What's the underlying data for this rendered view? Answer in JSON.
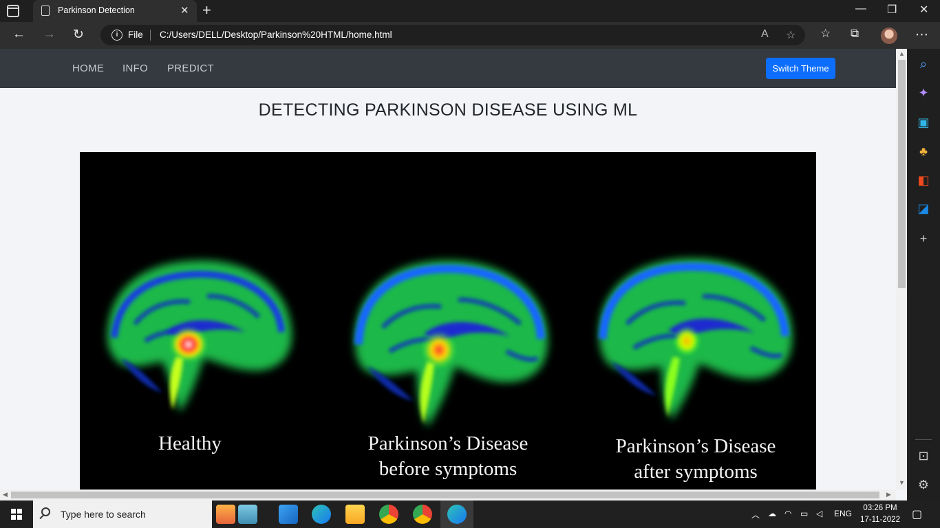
{
  "browser": {
    "tab_title": "Parkinson Detection",
    "tab_close_glyph": "✕",
    "new_tab_glyph": "+",
    "file_label": "File",
    "url": "C:/Users/DELL/Desktop/Parkinson%20HTML/home.html",
    "window_controls": [
      "—",
      "❐",
      "✕"
    ]
  },
  "site": {
    "nav_links": [
      "HOME",
      "INFO",
      "PREDICT"
    ],
    "switch_theme_label": "Switch Theme",
    "page_title": "DETECTING PARKINSON DISEASE USING ML",
    "hero_captions": [
      {
        "line1": "Healthy",
        "line2": ""
      },
      {
        "line1": "Parkinson’s Disease",
        "line2": "before symptoms"
      },
      {
        "line1": "Parkinson’s Disease",
        "line2": "after symptoms"
      }
    ]
  },
  "taskbar": {
    "search_placeholder": "Type here to search",
    "language": "ENG",
    "time": "03:26 PM",
    "date": "17-11-2022"
  },
  "colors": {
    "accent": "#0d6efd",
    "site_nav_bg": "#343a40",
    "page_bg": "#f3f4f7"
  },
  "icons": {
    "edge_sidebar": [
      "search-icon",
      "copilot-icon",
      "shopping-icon",
      "games-icon",
      "office-icon",
      "outlook-icon",
      "add-icon",
      "split-screen-icon",
      "settings-icon"
    ]
  }
}
